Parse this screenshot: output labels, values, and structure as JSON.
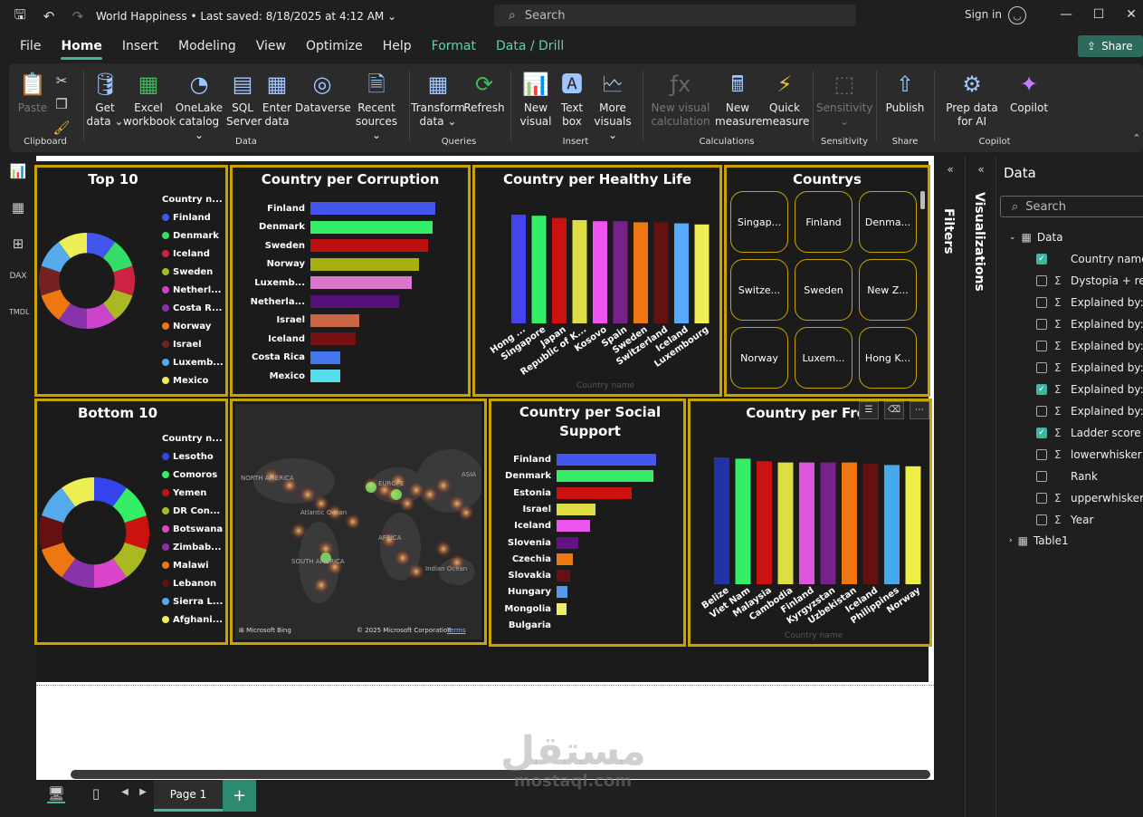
{
  "titlebar": {
    "title": "World Happiness",
    "saved": "Last saved: 8/18/2025 at 4:12 AM",
    "search_placeholder": "Search",
    "signin": "Sign in"
  },
  "menu": {
    "items": [
      "File",
      "Home",
      "Insert",
      "Modeling",
      "View",
      "Optimize",
      "Help",
      "Format",
      "Data / Drill"
    ],
    "active": "Home",
    "share": "Share"
  },
  "ribbon": {
    "groups": [
      {
        "label": "Clipboard",
        "buttons": [
          "Paste"
        ]
      },
      {
        "label": "Data",
        "buttons": [
          "Get data",
          "Excel workbook",
          "OneLake catalog",
          "SQL Server",
          "Enter data",
          "Dataverse",
          "Recent sources"
        ]
      },
      {
        "label": "Queries",
        "buttons": [
          "Transform data",
          "Refresh"
        ]
      },
      {
        "label": "Insert",
        "buttons": [
          "New visual",
          "Text box",
          "More visuals"
        ]
      },
      {
        "label": "Calculations",
        "buttons": [
          "New visual calculation",
          "New measure",
          "Quick measure"
        ]
      },
      {
        "label": "Sensitivity",
        "buttons": [
          "Sensitivity"
        ]
      },
      {
        "label": "Share",
        "buttons": [
          "Publish"
        ]
      },
      {
        "label": "Copilot",
        "buttons": [
          "Prep data for AI",
          "Copilot"
        ]
      }
    ]
  },
  "visuals": {
    "top10": {
      "title": "Top 10",
      "legend_header": "Country n...",
      "items": [
        {
          "name": "Finland",
          "color": "#4455ee"
        },
        {
          "name": "Denmark",
          "color": "#33dd66"
        },
        {
          "name": "Iceland",
          "color": "#cc2244"
        },
        {
          "name": "Sweden",
          "color": "#aab822"
        },
        {
          "name": "Netherl...",
          "color": "#cc44cc"
        },
        {
          "name": "Costa R...",
          "color": "#8833aa"
        },
        {
          "name": "Norway",
          "color": "#ee7711"
        },
        {
          "name": "Israel",
          "color": "#772222"
        },
        {
          "name": "Luxemb...",
          "color": "#55aaee"
        },
        {
          "name": "Mexico",
          "color": "#eeee55"
        }
      ]
    },
    "bottom10": {
      "title": "Bottom 10",
      "legend_header": "Country n...",
      "items": [
        {
          "name": "Lesotho",
          "color": "#3344ee"
        },
        {
          "name": "Comoros",
          "color": "#33ee66"
        },
        {
          "name": "Yemen",
          "color": "#cc1111"
        },
        {
          "name": "DR Con...",
          "color": "#aab822"
        },
        {
          "name": "Botswana",
          "color": "#dd44cc"
        },
        {
          "name": "Zimbab...",
          "color": "#8833aa"
        },
        {
          "name": "Malawi",
          "color": "#ee7711"
        },
        {
          "name": "Lebanon",
          "color": "#661111"
        },
        {
          "name": "Sierra L...",
          "color": "#55aaee"
        },
        {
          "name": "Afghani...",
          "color": "#eeee55"
        }
      ]
    },
    "corruption": {
      "title": "Country per Corruption",
      "categories": [
        "Finland",
        "Denmark",
        "Sweden",
        "Norway",
        "Luxemb...",
        "Netherla...",
        "Israel",
        "Iceland",
        "Costa Rica",
        "Mexico"
      ],
      "values": [
        100,
        98,
        94,
        87,
        81,
        71,
        39,
        36,
        24,
        24
      ],
      "colors": [
        "#4455ee",
        "#33ee66",
        "#bb1111",
        "#a8b010",
        "#dd77cc",
        "#551177",
        "#cc6644",
        "#771111",
        "#4477ee",
        "#55ddee"
      ]
    },
    "healthy": {
      "title": "Country per Healthy Life",
      "categories": [
        "Hong ...",
        "Singapore",
        "Japan",
        "Republic of K...",
        "Kosovo",
        "Spain",
        "Sweden",
        "Switzerland",
        "Iceland",
        "Luxembourg"
      ],
      "values": [
        100,
        99,
        97,
        95,
        94,
        94,
        93,
        93,
        92,
        91
      ],
      "colors": [
        "#4444ee",
        "#33ee66",
        "#cc1111",
        "#dddd44",
        "#ee55ee",
        "#772288",
        "#ee7711",
        "#661111",
        "#55aaff",
        "#eeee55"
      ],
      "axis_title": "Country name"
    },
    "countries": {
      "title": "Countrys",
      "tiles": [
        "Singap...",
        "Finland",
        "Denma...",
        "Switze...",
        "Sweden",
        "New Z...",
        "Norway",
        "Luxem...",
        "Hong K..."
      ]
    },
    "map": {
      "labels": [
        "NORTH AMERICA",
        "EUROPE",
        "ASIA",
        "Atlantic Ocean",
        "AFRICA",
        "SOUTH AMERICA",
        "Indian Ocean"
      ],
      "brand": "Microsoft Bing",
      "copyright": "© 2025 Microsoft Corporation",
      "terms": "Terms"
    },
    "social": {
      "title": "Country per Social Support",
      "categories": [
        "Finland",
        "Denmark",
        "Estonia",
        "Israel",
        "Iceland",
        "Slovenia",
        "Czechia",
        "Slovakia",
        "Hungary",
        "Mongolia",
        "Bulgaria"
      ],
      "values": [
        100,
        97,
        75,
        39,
        34,
        22,
        16,
        14,
        11,
        10,
        0
      ],
      "colors": [
        "#4455ee",
        "#33ee66",
        "#cc1111",
        "#dddd44",
        "#ee55ee",
        "#661188",
        "#ee7711",
        "#661111",
        "#5599ee",
        "#eeee66",
        "#333333"
      ]
    },
    "freedom": {
      "title": "Country per Free",
      "categories": [
        "Belize",
        "Viet Nam",
        "Malaysia",
        "Cambodia",
        "Finland",
        "Kyrgyzstan",
        "Uzbekistan",
        "Iceland",
        "Philippines",
        "Norway"
      ],
      "values": [
        100,
        99,
        97,
        96,
        96,
        96,
        96,
        95,
        94,
        93
      ],
      "colors": [
        "#2233aa",
        "#33ee66",
        "#cc1111",
        "#dddd44",
        "#dd55dd",
        "#772288",
        "#ee7711",
        "#661111",
        "#44aaee",
        "#eeee44"
      ],
      "axis_title": "Country name"
    }
  },
  "pages": {
    "tab": "Page 1",
    "add": "+"
  },
  "panes": {
    "filters": "Filters",
    "visualizations": "Visualizations",
    "data_title": "Data",
    "search_placeholder": "Search",
    "table": "Data",
    "fields": [
      {
        "name": "Country name",
        "checked": true,
        "sigma": false
      },
      {
        "name": "Dystopia + resi...",
        "checked": false,
        "sigma": true
      },
      {
        "name": "Explained by: F...",
        "checked": false,
        "sigma": true
      },
      {
        "name": "Explained by: G...",
        "checked": false,
        "sigma": true
      },
      {
        "name": "Explained by: H...",
        "checked": false,
        "sigma": true
      },
      {
        "name": "Explained by: L...",
        "checked": false,
        "sigma": true
      },
      {
        "name": "Explained by: P...",
        "checked": true,
        "sigma": true
      },
      {
        "name": "Explained by: S...",
        "checked": false,
        "sigma": true
      },
      {
        "name": "Ladder score",
        "checked": true,
        "sigma": true
      },
      {
        "name": "lowerwhisker",
        "checked": false,
        "sigma": true
      },
      {
        "name": "Rank",
        "checked": false,
        "sigma": false
      },
      {
        "name": "upperwhisker",
        "checked": false,
        "sigma": true
      },
      {
        "name": "Year",
        "checked": false,
        "sigma": true
      }
    ],
    "table2": "Table1"
  },
  "watermark": {
    "arabic": "مستقل",
    "latin": "mostaql.com"
  }
}
